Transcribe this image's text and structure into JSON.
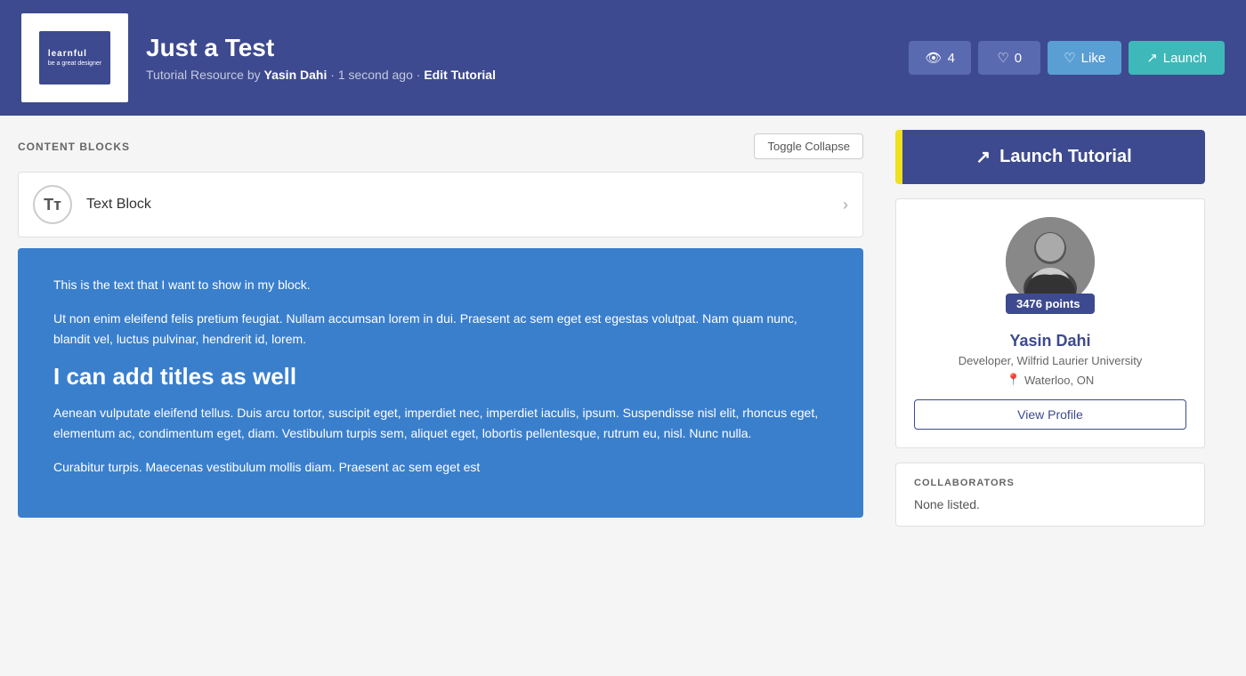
{
  "header": {
    "title": "Just a Test",
    "meta_prefix": "Tutorial Resource by ",
    "author": "Yasin Dahi",
    "time": "1 second ago",
    "edit_link": "Edit Tutorial",
    "views_count": "4",
    "likes_count": "0",
    "like_label": "Like",
    "launch_label": "Launch"
  },
  "content_blocks": {
    "section_title": "CONTENT BLOCKS",
    "toggle_label": "Toggle Collapse",
    "block": {
      "label": "Text Block",
      "icon": "Tт"
    },
    "preview": {
      "para1": "This is the text that I want to show in my block.",
      "para2": "Ut non enim eleifend felis pretium feugiat. Nullam accumsan lorem in dui. Praesent ac sem eget est egestas volutpat. Nam quam nunc, blandit vel, luctus pulvinar, hendrerit id, lorem.",
      "heading": "I can add titles as well",
      "para3": "Aenean vulputate eleifend tellus. Duis arcu tortor, suscipit eget, imperdiet nec, imperdiet iaculis, ipsum. Suspendisse nisl elit, rhoncus eget, elementum ac, condimentum eget, diam. Vestibulum turpis sem, aliquet eget, lobortis pellentesque, rutrum eu, nisl. Nunc nulla.",
      "para4": "Curabitur turpis. Maecenas vestibulum mollis diam. Praesent ac sem eget est"
    }
  },
  "sidebar": {
    "launch_button_label": "Launch Tutorial",
    "author_card": {
      "points": "3476 points",
      "name": "Yasin Dahi",
      "role": "Developer, Wilfrid Laurier University",
      "location": "Waterloo, ON",
      "view_profile_label": "View Profile"
    },
    "collaborators": {
      "title": "COLLABORATORS",
      "none_text": "None listed."
    }
  }
}
